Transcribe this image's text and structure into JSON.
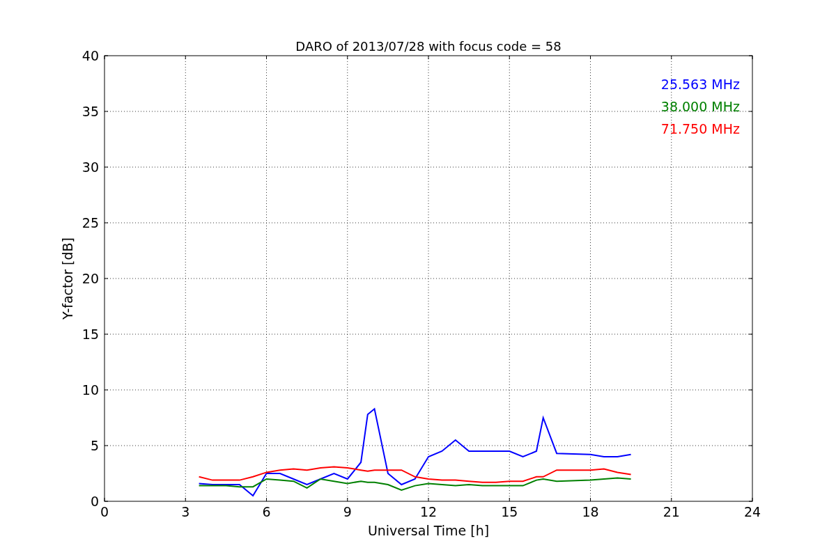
{
  "chart_data": {
    "type": "line",
    "title": "DARO of 2013/07/28 with focus code = 58",
    "xlabel": "Universal Time [h]",
    "ylabel": "Y-factor [dB]",
    "x": [
      3.5,
      4,
      4.5,
      5,
      5.5,
      6,
      6.5,
      7,
      7.5,
      8,
      8.5,
      9,
      9.5,
      9.75,
      10,
      10.5,
      11,
      11.5,
      12,
      12.5,
      13,
      13.5,
      14,
      14.5,
      15,
      15.5,
      16,
      16.25,
      16.75,
      18,
      18.5,
      19,
      19.5
    ],
    "series": [
      {
        "name": "25.563 MHz",
        "color": "#0000ff",
        "values": [
          1.6,
          1.5,
          1.5,
          1.5,
          0.5,
          2.5,
          2.5,
          2.0,
          1.5,
          2.0,
          2.5,
          2.0,
          3.5,
          7.8,
          8.3,
          2.5,
          1.5,
          2.0,
          4.0,
          4.5,
          5.5,
          4.5,
          4.5,
          4.5,
          4.5,
          4.0,
          4.5,
          7.5,
          4.3,
          4.2,
          4.0,
          4.0,
          4.2
        ]
      },
      {
        "name": "38.000 MHz",
        "color": "#008000",
        "values": [
          1.4,
          1.4,
          1.4,
          1.3,
          1.3,
          2.0,
          1.9,
          1.8,
          1.2,
          2.0,
          1.8,
          1.6,
          1.8,
          1.7,
          1.7,
          1.5,
          1.0,
          1.4,
          1.6,
          1.5,
          1.4,
          1.5,
          1.4,
          1.4,
          1.4,
          1.4,
          1.9,
          2.0,
          1.8,
          1.9,
          2.0,
          2.1,
          2.0
        ]
      },
      {
        "name": "71.750 MHz",
        "color": "#ff0000",
        "values": [
          2.2,
          1.9,
          1.9,
          1.9,
          2.2,
          2.6,
          2.8,
          2.9,
          2.8,
          3.0,
          3.1,
          3.0,
          2.8,
          2.7,
          2.8,
          2.8,
          2.8,
          2.2,
          2.0,
          1.9,
          1.9,
          1.8,
          1.7,
          1.7,
          1.8,
          1.8,
          2.2,
          2.2,
          2.8,
          2.8,
          2.9,
          2.6,
          2.4
        ]
      }
    ],
    "xlim": [
      0,
      24
    ],
    "ylim": [
      0,
      40
    ],
    "xticks": [
      0,
      3,
      6,
      9,
      12,
      15,
      18,
      21,
      24
    ],
    "yticks": [
      0,
      5,
      10,
      15,
      20,
      25,
      30,
      35,
      40
    ],
    "grid": true
  }
}
